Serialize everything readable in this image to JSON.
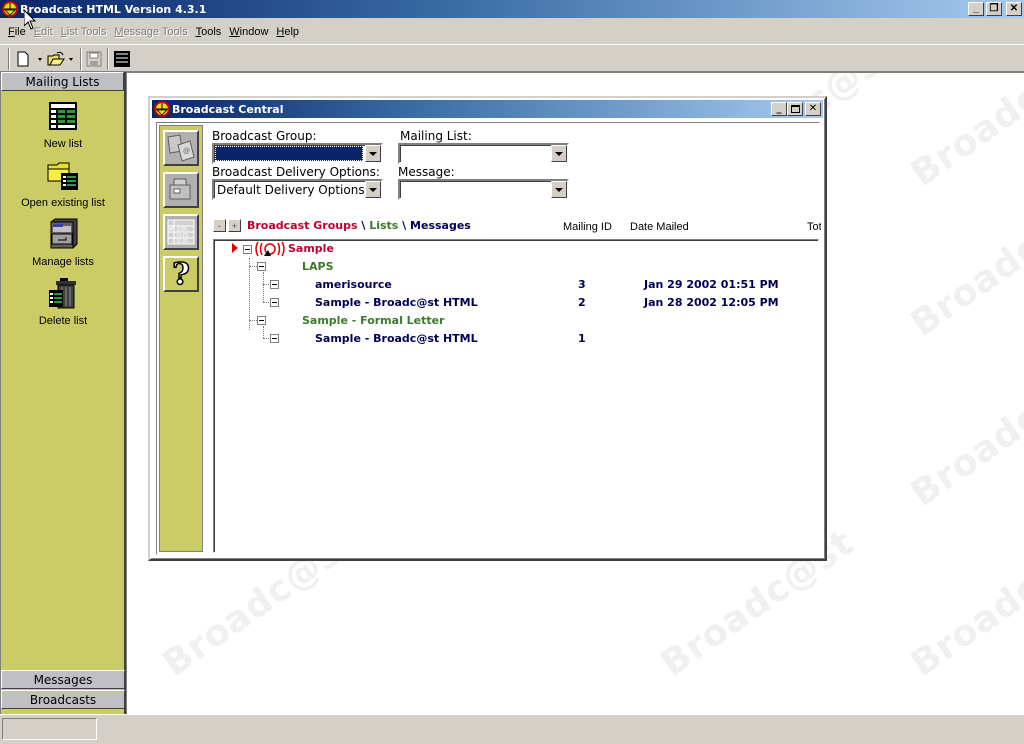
{
  "app": {
    "title": "Broadcast HTML  Version 4.3.1",
    "window_controls": {
      "minimize": "_",
      "restore": "❐",
      "close": "✕"
    }
  },
  "menu": [
    {
      "label": "File",
      "accel": "F",
      "rest": "ile",
      "enabled": true
    },
    {
      "label": "Edit",
      "accel": "E",
      "rest": "dit",
      "enabled": false
    },
    {
      "label": "List Tools",
      "accel": "L",
      "rest": "ist Tools",
      "enabled": false
    },
    {
      "label": "Message Tools",
      "accel": "M",
      "rest": "essage Tools",
      "enabled": false
    },
    {
      "label": "Tools",
      "accel": "T",
      "rest": "ools",
      "enabled": true
    },
    {
      "label": "Window",
      "accel": "W",
      "rest": "indow",
      "enabled": true
    },
    {
      "label": "Help",
      "accel": "H",
      "rest": "elp",
      "enabled": true
    }
  ],
  "toolbar": {
    "buttons": [
      {
        "name": "new-document",
        "icon": "new-document-icon"
      },
      {
        "name": "open-folder",
        "icon": "open-folder-icon"
      },
      {
        "name": "save",
        "icon": "save-icon",
        "enabled": false
      },
      {
        "name": "list-view",
        "icon": "list-view-icon"
      }
    ]
  },
  "sidebar": {
    "header": "Mailing Lists",
    "items": [
      {
        "label": "New list",
        "icon": "new-list-icon"
      },
      {
        "label": "Open existing list",
        "icon": "open-list-icon"
      },
      {
        "label": "Manage lists",
        "icon": "manage-lists-icon"
      },
      {
        "label": "Delete list",
        "icon": "delete-list-icon"
      }
    ],
    "footer_tabs": [
      "Messages",
      "Broadcasts"
    ]
  },
  "watermark_text": "Broadc@st",
  "child_window": {
    "title": "Broadcast Central",
    "fields": {
      "broadcast_group": {
        "label": "Broadcast Group:",
        "value": ""
      },
      "mailing_list": {
        "label": "Mailing List:",
        "value": ""
      },
      "delivery_options": {
        "label": "Broadcast Delivery Options:",
        "value": "Default Delivery Options"
      },
      "message": {
        "label": "Message:",
        "value": ""
      }
    },
    "collapse_label": "-",
    "expand_label": "+",
    "breadcrumb": {
      "groups": "Broadcast Groups",
      "sep1": " \\ ",
      "lists": "Lists",
      "sep2": " \\ ",
      "messages": "Messages"
    },
    "columns": [
      "Mailing ID",
      "Date Mailed",
      "Tota"
    ],
    "tree": {
      "group": "Sample",
      "lists": [
        {
          "name": "LAPS",
          "messages": [
            {
              "name": "amerisource",
              "mailing_id": "3",
              "date_mailed": "Jan 29 2002  01:51 PM"
            },
            {
              "name": "Sample - Broadc@st HTML",
              "mailing_id": "2",
              "date_mailed": "Jan 28 2002  12:05 PM"
            }
          ]
        },
        {
          "name": "Sample - Formal Letter",
          "messages": [
            {
              "name": "Sample - Broadc@st HTML",
              "mailing_id": "1",
              "date_mailed": ""
            }
          ]
        }
      ]
    },
    "help_symbol": "?"
  },
  "colors": {
    "sidebar_bg": "#cccc66",
    "title_start": "#0a246a",
    "title_end": "#a6caf0",
    "group_red": "#c00030",
    "list_green": "#3a7a2a",
    "message_navy": "#000050"
  }
}
